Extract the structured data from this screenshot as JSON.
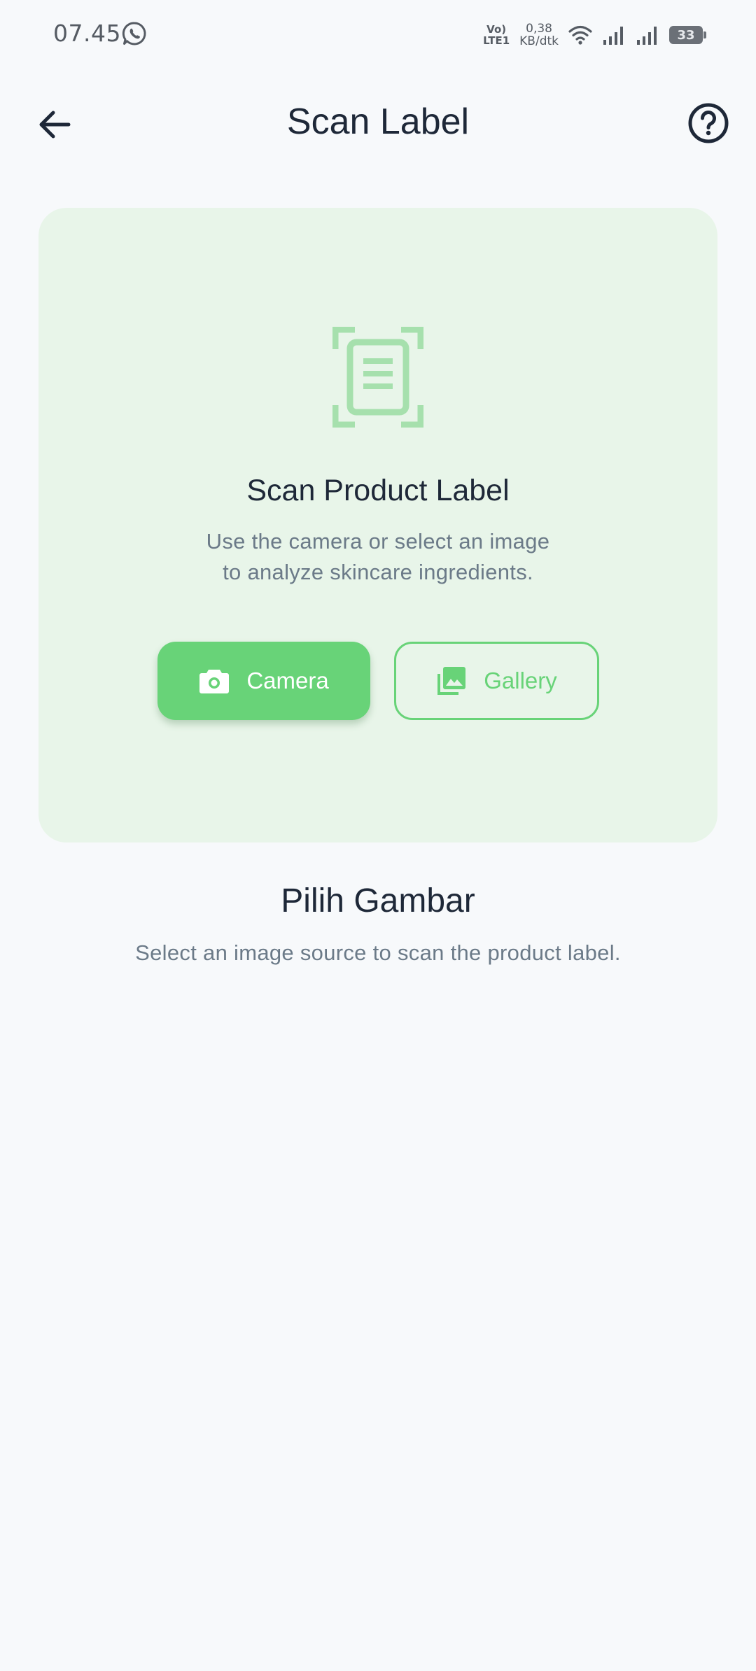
{
  "status_bar": {
    "time": "07.45",
    "volte_line1": "Vo)",
    "volte_line2": "LTE1",
    "speed_value": "0,38",
    "speed_unit": "KB/dtk",
    "battery": "33",
    "icons": [
      "whatsapp-icon",
      "wifi-icon",
      "signal-icon",
      "signal-icon",
      "battery-icon"
    ]
  },
  "app_bar": {
    "title": "Scan Label",
    "back_icon": "arrow-left-icon",
    "help_icon": "help-circle-icon"
  },
  "scan_card": {
    "icon": "document-scanner-icon",
    "title": "Scan Product Label",
    "description_line1": "Use the camera or select an image",
    "description_line2": "to analyze skincare ingredients.",
    "camera_label": "Camera",
    "gallery_label": "Gallery"
  },
  "section": {
    "title": "Pilih Gambar",
    "description": "Select an image source to scan the product label."
  },
  "colors": {
    "accent": "#68d378",
    "card_bg": "#e8f5e9",
    "page_bg": "#f7f9fb",
    "title_text": "#1e2838",
    "muted_text": "#6b7a88",
    "scan_icon": "#a6e0ad"
  }
}
